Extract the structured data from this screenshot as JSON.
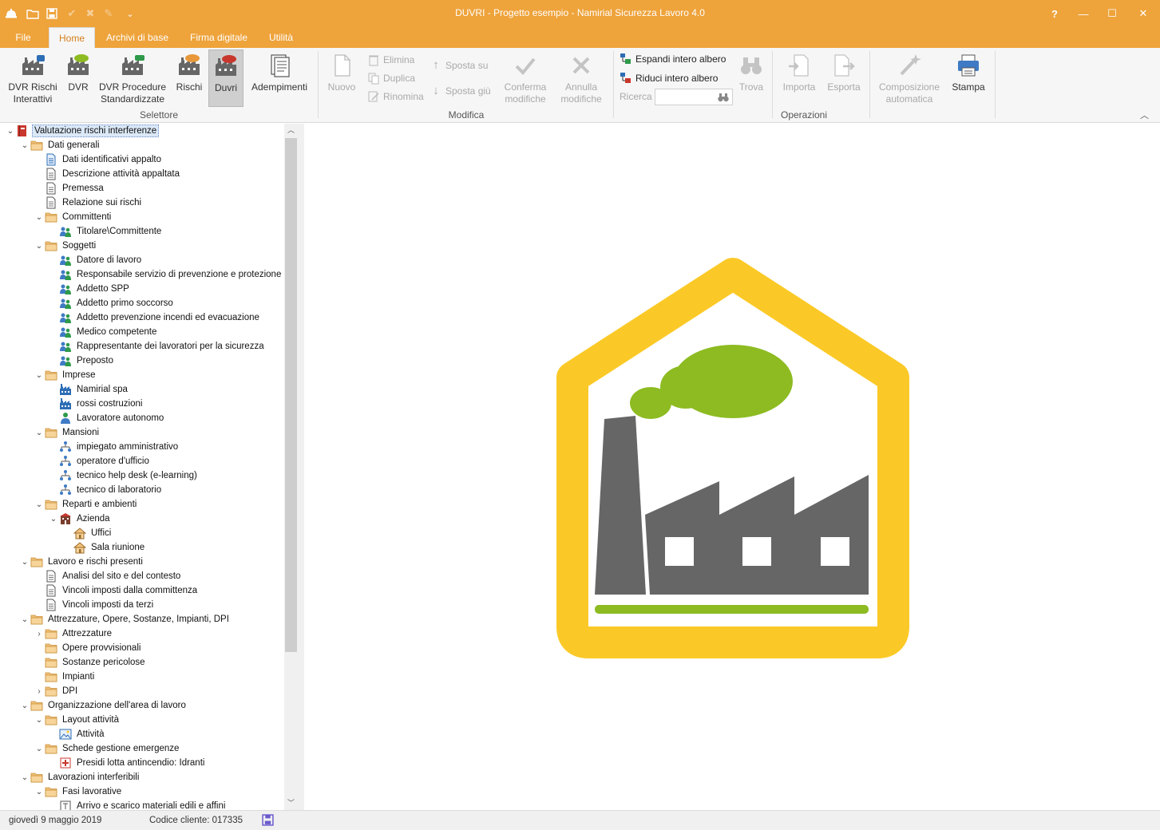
{
  "window": {
    "title": "DUVRI - Progetto esempio - Namirial Sicurezza Lavoro 4.0",
    "help": "?",
    "minimize": "—",
    "maximize": "☐",
    "close": "✕"
  },
  "quick_access": {
    "app_icon": "hardhat-icon",
    "open": "folder-icon",
    "save": "save-icon",
    "check": "✔",
    "cancel": "✖",
    "edit": "✎",
    "more": "⌄"
  },
  "tabs": [
    "File",
    "Home",
    "Archivi di base",
    "Firma digitale",
    "Utilità"
  ],
  "ribbon": {
    "selettore": {
      "label": "Selettore",
      "buttons": [
        {
          "l1": "DVR Rischi",
          "l2": "Interattivi"
        },
        {
          "l1": "DVR",
          "l2": ""
        },
        {
          "l1": "DVR Procedure",
          "l2": "Standardizzate"
        },
        {
          "l1": "Rischi",
          "l2": ""
        },
        {
          "l1": "Duvri",
          "l2": ""
        },
        {
          "l1": "Adempimenti",
          "l2": ""
        }
      ]
    },
    "modifica": {
      "label": "Modifica",
      "nuovo": "Nuovo",
      "elimina": "Elimina",
      "duplica": "Duplica",
      "rinomina": "Rinomina",
      "sposta_su": "Sposta su",
      "sposta_giu": "Sposta giù",
      "conferma": {
        "l1": "Conferma",
        "l2": "modifiche"
      },
      "annulla": {
        "l1": "Annulla",
        "l2": "modifiche"
      }
    },
    "operazioni": {
      "label": "Operazioni",
      "espandi": "Espandi intero albero",
      "riduci": "Riduci intero albero",
      "ricerca": "Ricerca",
      "ricerca_value": "",
      "trova": "Trova",
      "importa": "Importa",
      "esporta": "Esporta",
      "composizione": {
        "l1": "Composizione",
        "l2": "automatica"
      },
      "stampa": "Stampa"
    }
  },
  "tree": [
    {
      "label": "Valutazione rischi interferenze",
      "icon": "book-icon",
      "toggle": "⌄"
    },
    {
      "label": "Dati generali",
      "icon": "folder-icon",
      "toggle": "⌄"
    },
    {
      "label": "Dati identificativi appalto",
      "icon": "document-blue-icon",
      "toggle": ""
    },
    {
      "label": "Descrizione attività appaltata",
      "icon": "document-icon",
      "toggle": ""
    },
    {
      "label": "Premessa",
      "icon": "document-icon",
      "toggle": ""
    },
    {
      "label": "Relazione sui rischi",
      "icon": "document-icon",
      "toggle": ""
    },
    {
      "label": "Committenti",
      "icon": "folder-icon",
      "toggle": "⌄"
    },
    {
      "label": "Titolare\\Committente",
      "icon": "people-icon",
      "toggle": ""
    },
    {
      "label": "Soggetti",
      "icon": "folder-icon",
      "toggle": "⌄"
    },
    {
      "label": "Datore di lavoro",
      "icon": "people-icon",
      "toggle": ""
    },
    {
      "label": "Responsabile servizio di prevenzione e protezione",
      "icon": "people-icon",
      "toggle": ""
    },
    {
      "label": "Addetto SPP",
      "icon": "people-icon",
      "toggle": ""
    },
    {
      "label": "Addetto primo soccorso",
      "icon": "people-icon",
      "toggle": ""
    },
    {
      "label": "Addetto prevenzione incendi ed evacuazione",
      "icon": "people-icon",
      "toggle": ""
    },
    {
      "label": "Medico competente",
      "icon": "people-icon",
      "toggle": ""
    },
    {
      "label": "Rappresentante dei lavoratori per la sicurezza",
      "icon": "people-icon",
      "toggle": ""
    },
    {
      "label": "Preposto",
      "icon": "people-icon",
      "toggle": ""
    },
    {
      "label": "Imprese",
      "icon": "folder-icon",
      "toggle": "⌄"
    },
    {
      "label": "Namirial spa",
      "icon": "factory-icon",
      "toggle": ""
    },
    {
      "label": "rossi costruzioni",
      "icon": "factory-icon",
      "toggle": ""
    },
    {
      "label": "Lavoratore autonomo",
      "icon": "worker-icon",
      "toggle": ""
    },
    {
      "label": "Mansioni",
      "icon": "folder-icon",
      "toggle": "⌄"
    },
    {
      "label": "impiegato amministrativo",
      "icon": "org-chart-icon",
      "toggle": ""
    },
    {
      "label": "operatore d'ufficio",
      "icon": "org-chart-icon",
      "toggle": ""
    },
    {
      "label": "tecnico help desk (e-learning)",
      "icon": "org-chart-icon",
      "toggle": ""
    },
    {
      "label": "tecnico di laboratorio",
      "icon": "org-chart-icon",
      "toggle": ""
    },
    {
      "label": "Reparti e ambienti",
      "icon": "folder-icon",
      "toggle": "⌄"
    },
    {
      "label": "Azienda",
      "icon": "building-icon",
      "toggle": "⌄"
    },
    {
      "label": "Uffici",
      "icon": "house-icon",
      "toggle": ""
    },
    {
      "label": "Sala riunione",
      "icon": "house-icon",
      "toggle": ""
    },
    {
      "label": "Lavoro e rischi presenti",
      "icon": "folder-icon",
      "toggle": "⌄"
    },
    {
      "label": "Analisi del sito e del contesto",
      "icon": "document-icon",
      "toggle": ""
    },
    {
      "label": "Vincoli imposti dalla committenza",
      "icon": "document-icon",
      "toggle": ""
    },
    {
      "label": "Vincoli imposti da terzi",
      "icon": "document-icon",
      "toggle": ""
    },
    {
      "label": "Attrezzature, Opere, Sostanze, Impianti, DPI",
      "icon": "folder-icon",
      "toggle": "⌄"
    },
    {
      "label": "Attrezzature",
      "icon": "folder-icon",
      "toggle": "›"
    },
    {
      "label": "Opere provvisionali",
      "icon": "folder-icon",
      "toggle": ""
    },
    {
      "label": "Sostanze pericolose",
      "icon": "folder-icon",
      "toggle": ""
    },
    {
      "label": "Impianti",
      "icon": "folder-icon",
      "toggle": ""
    },
    {
      "label": "DPI",
      "icon": "folder-icon",
      "toggle": "›"
    },
    {
      "label": "Organizzazione dell'area di lavoro",
      "icon": "folder-icon",
      "toggle": "⌄"
    },
    {
      "label": "Layout attività",
      "icon": "folder-icon",
      "toggle": "⌄"
    },
    {
      "label": "Attività",
      "icon": "image-icon",
      "toggle": ""
    },
    {
      "label": "Schede gestione emergenze",
      "icon": "folder-icon",
      "toggle": "⌄"
    },
    {
      "label": "Presidi lotta antincendio: Idranti",
      "icon": "first-aid-icon",
      "toggle": ""
    },
    {
      "label": "Lavorazioni interferibili",
      "icon": "folder-icon",
      "toggle": "⌄"
    },
    {
      "label": "Fasi lavorative",
      "icon": "folder-icon",
      "toggle": "⌄"
    },
    {
      "label": "Arrivo e scarico materiali edili e affini",
      "icon": "task-icon",
      "toggle": ""
    }
  ],
  "status": {
    "date": "giovedì 9 maggio 2019",
    "client_code": "Codice cliente: 017335",
    "save_icon": "save-icon"
  },
  "colors": {
    "accent": "#eea33b",
    "logo_yellow": "#fbc927",
    "logo_green": "#8dbb21",
    "logo_gray": "#666666"
  }
}
